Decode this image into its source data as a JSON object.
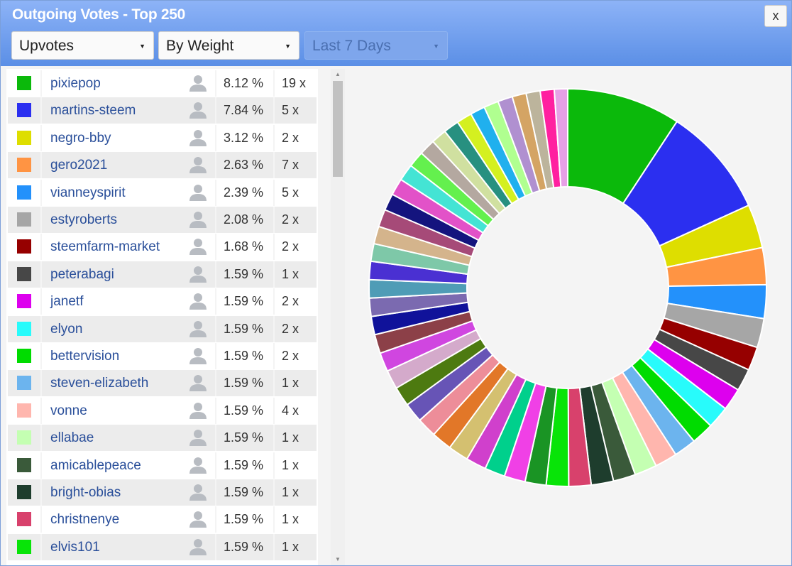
{
  "window": {
    "title": "Outgoing Votes - Top 250",
    "close_label": "x"
  },
  "filters": {
    "vote_type": "Upvotes",
    "sort_by": "By Weight",
    "period": "Last 7 Days",
    "period_disabled": true
  },
  "votes": [
    {
      "name": "pixiepop",
      "pct": "8.12 %",
      "count": "19 x",
      "color": "#0bb90b"
    },
    {
      "name": "martins-steem",
      "pct": "7.84 %",
      "count": "5 x",
      "color": "#2b2ff0"
    },
    {
      "name": "negro-bby",
      "pct": "3.12 %",
      "count": "2 x",
      "color": "#dede00"
    },
    {
      "name": "gero2021",
      "pct": "2.63 %",
      "count": "7 x",
      "color": "#ff9443"
    },
    {
      "name": "vianneyspirit",
      "pct": "2.39 %",
      "count": "5 x",
      "color": "#2391fb"
    },
    {
      "name": "estyroberts",
      "pct": "2.08 %",
      "count": "2 x",
      "color": "#a6a6a6"
    },
    {
      "name": "steemfarm-market",
      "pct": "1.68 %",
      "count": "2 x",
      "color": "#960000"
    },
    {
      "name": "peterabagi",
      "pct": "1.59 %",
      "count": "1 x",
      "color": "#474747"
    },
    {
      "name": "janetf",
      "pct": "1.59 %",
      "count": "2 x",
      "color": "#dd00ee"
    },
    {
      "name": "elyon",
      "pct": "1.59 %",
      "count": "2 x",
      "color": "#28fbfb"
    },
    {
      "name": "bettervision",
      "pct": "1.59 %",
      "count": "2 x",
      "color": "#00dc00"
    },
    {
      "name": "steven-elizabeth",
      "pct": "1.59 %",
      "count": "1 x",
      "color": "#6cb4ee"
    },
    {
      "name": "vonne",
      "pct": "1.59 %",
      "count": "4 x",
      "color": "#ffb6ae"
    },
    {
      "name": "ellabae",
      "pct": "1.59 %",
      "count": "1 x",
      "color": "#c4ffb2"
    },
    {
      "name": "amicablepeace",
      "pct": "1.59 %",
      "count": "1 x",
      "color": "#3a5a3a"
    },
    {
      "name": "bright-obias",
      "pct": "1.59 %",
      "count": "1 x",
      "color": "#1e3d2d"
    },
    {
      "name": "christnenye",
      "pct": "1.59 %",
      "count": "1 x",
      "color": "#d8416c"
    },
    {
      "name": "elvis101",
      "pct": "1.59 %",
      "count": "1 x",
      "color": "#08e408"
    }
  ],
  "chart_data": {
    "type": "pie",
    "donut": true,
    "values": [
      8.12,
      7.84,
      3.12,
      2.63,
      2.39,
      2.08,
      1.68,
      1.59,
      1.59,
      1.59,
      1.59,
      1.59,
      1.59,
      1.59,
      1.59,
      1.59,
      1.59,
      1.59,
      1.5,
      1.5,
      1.45,
      1.45,
      1.45,
      1.45,
      1.4,
      1.4,
      1.4,
      1.35,
      1.35,
      1.35,
      1.3,
      1.3,
      1.3,
      1.3,
      1.25,
      1.25,
      1.25,
      1.2,
      1.2,
      1.2,
      1.15,
      1.15,
      1.1,
      1.1,
      1.1,
      1.05,
      1.05,
      1.05,
      1.0,
      1.0,
      1.0,
      0.95
    ],
    "colors": [
      "#0bb90b",
      "#2b2ff0",
      "#dede00",
      "#ff9443",
      "#2391fb",
      "#a6a6a6",
      "#960000",
      "#474747",
      "#dd00ee",
      "#28fbfb",
      "#00dc00",
      "#6cb4ee",
      "#ffb6ae",
      "#c4ffb2",
      "#3a5a3a",
      "#1e3d2d",
      "#d8416c",
      "#08e408",
      "#1a9424",
      "#f040e6",
      "#00d08c",
      "#d040cc",
      "#d4c070",
      "#e27728",
      "#ed8d99",
      "#6754b6",
      "#4d7a10",
      "#d4aacb",
      "#d046e0",
      "#8c4048",
      "#10129a",
      "#7b6ab0",
      "#4f9cb6",
      "#4a30d2",
      "#7ec8a8",
      "#d4b48c",
      "#a64a78",
      "#14147e",
      "#e252c8",
      "#44e4d4",
      "#64f04e",
      "#b4a8a0",
      "#d0e0a0",
      "#279080",
      "#d4f020",
      "#20b0ee",
      "#b0ff90",
      "#b090d0",
      "#d4a464",
      "#bcb49c",
      "#ff20a0",
      "#e6a0e6"
    ]
  }
}
